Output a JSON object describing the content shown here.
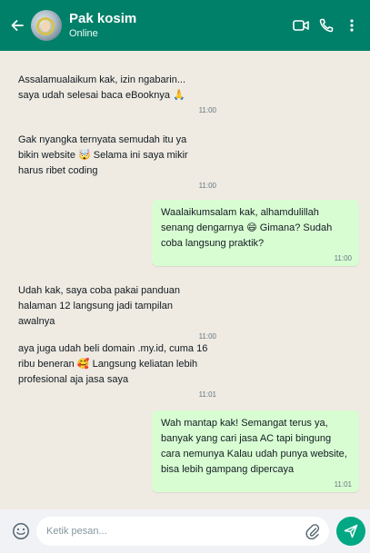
{
  "header": {
    "contact_name": "Pak kosim",
    "status": "Online",
    "color": "#008069"
  },
  "icons": {
    "back": "arrow-left",
    "video": "video-camera",
    "call": "phone",
    "menu": "vertical-dots",
    "emoji": "smiley",
    "attach": "paperclip",
    "send": "paper-plane"
  },
  "messages": [
    {
      "direction": "incoming",
      "text": "Assalamualaikum kak, izin ngabarin... saya udah selesai baca eBooknya 🙏",
      "time": "11:00"
    },
    {
      "direction": "incoming",
      "text": "Gak nyangka ternyata semudah itu ya bikin website 🤯 Selama ini saya mikir harus ribet coding",
      "time": "11:00"
    },
    {
      "direction": "outgoing",
      "text": "Waalaikumsalam kak, alhamdulillah senang dengarnya 😄 Gimana? Sudah coba langsung praktik?",
      "time": "11:00"
    },
    {
      "direction": "incoming",
      "text": "Udah kak, saya coba pakai panduan halaman 12 langsung jadi tampilan awalnya",
      "time": "11:00"
    },
    {
      "direction": "incoming",
      "text": "aya juga udah beli domain .my.id, cuma 16 ribu beneran 🥰 Langsung keliatan lebih profesional aja jasa saya",
      "time": "11:01"
    },
    {
      "direction": "outgoing",
      "text": "Wah mantap kak! Semangat terus ya, banyak yang cari jasa AC tapi bingung cara nemunya Kalau udah punya website, bisa lebih gampang dipercaya",
      "time": "11:01"
    }
  ],
  "composer": {
    "placeholder": "Ketik pesan..."
  },
  "colors": {
    "outgoing_bubble": "#d9fdd3",
    "chat_background": "#efeae2",
    "send_button": "#00a884"
  }
}
